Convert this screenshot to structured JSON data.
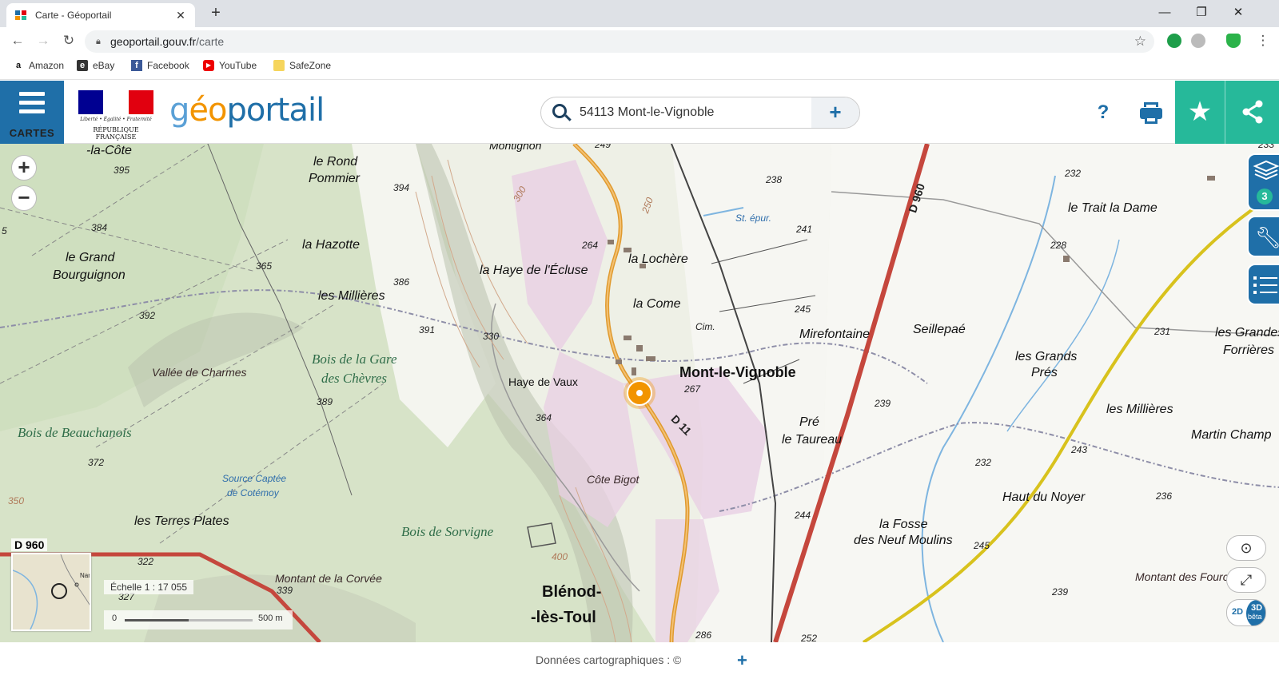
{
  "browser": {
    "tab_title": "Carte - Géoportail",
    "url_host": "geoportail.gouv.fr",
    "url_path": "/carte",
    "bookmarks": [
      "Amazon",
      "eBay",
      "Facebook",
      "YouTube",
      "SafeZone"
    ]
  },
  "header": {
    "menu_label": "CARTES",
    "logo_motto": "Liberté • Égalité • Fraternité",
    "logo_republic": "RÉPUBLIQUE FRANÇAISE",
    "brand_g": "g",
    "brand_eo": "éo",
    "brand_portail": "portail",
    "search_value": "54113 Mont-le-Vignoble",
    "help_label": "?"
  },
  "map": {
    "layers_count": "3",
    "scale_label": "Échelle 1 : 17 055",
    "scale_start": "0",
    "scale_end": "500 m",
    "view_2d": "2D",
    "view_3d": "3D",
    "view_3d_sub": "bêta",
    "minimap_label": "Nan",
    "road_d960_corner": "D 960",
    "labels": {
      "town_main": "Mont-le-Vignoble",
      "town_blenod_1": "Blénod-",
      "town_blenod_2": "-lès-Toul",
      "la_cote": "-la-Côte",
      "montignon": "Montignon",
      "rond_pommier_1": "le Rond",
      "rond_pommier_2": "Pommier",
      "hazotte": "la Hazotte",
      "grand_bourguignon_1": "le Grand",
      "grand_bourguignon_2": "Bourguignon",
      "millieres_w": "les Millières",
      "haye_ecluse": "la Haye de l'Écluse",
      "lochere": "la Lochère",
      "come": "la Come",
      "cim": "Cim.",
      "st_epur": "St. épur.",
      "mirefontaine": "Mirefontaine",
      "seillepae": "Seillepaé",
      "trait_la_dame": "le Trait la Dame",
      "grandes_forrieres_1": "les Grandes",
      "grandes_forrieres_2": "Forrières",
      "grands_pres_1": "les Grands",
      "grands_pres_2": "Prés",
      "millieres_e": "les Millières",
      "martin_champ": "Martin Champ",
      "vallee_charmes": "Vallée de Charmes",
      "bois_gare_1": "Bois de la Gare",
      "bois_gare_2": "des Chèvres",
      "bois_beauchanois": "Bois de Beauchanois",
      "haye_vaux": "Haye de Vaux",
      "pre_taureau_1": "Pré",
      "pre_taureau_2": "le Taureau",
      "source_1": "Source Captée",
      "source_2": "de Cotémoy",
      "terres_plates": "les Terres Plates",
      "cote_bigot": "Côte Bigot",
      "bois_sorvigne": "Bois de Sorvigne",
      "montant_corvee": "Montant de la Corvée",
      "haut_noyer": "Haut du Noyer",
      "fosse_1": "la Fosse",
      "fosse_2": "des Neuf Moulins",
      "montant_fourches": "Montant des Fourches",
      "d960": "D 960",
      "d11": "D 11"
    },
    "elevations": [
      "249",
      "395",
      "394",
      "384",
      "365",
      "386",
      "392",
      "391",
      "330",
      "389",
      "372",
      "364",
      "264",
      "267",
      "238",
      "241",
      "245",
      "239",
      "232",
      "228",
      "231",
      "243",
      "236",
      "244",
      "245",
      "239",
      "232",
      "322",
      "327",
      "339",
      "286",
      "252",
      "233",
      "350",
      "300",
      "250",
      "400",
      "5"
    ]
  },
  "footer": {
    "credits": "Données cartographiques : ©",
    "plus": "+"
  }
}
